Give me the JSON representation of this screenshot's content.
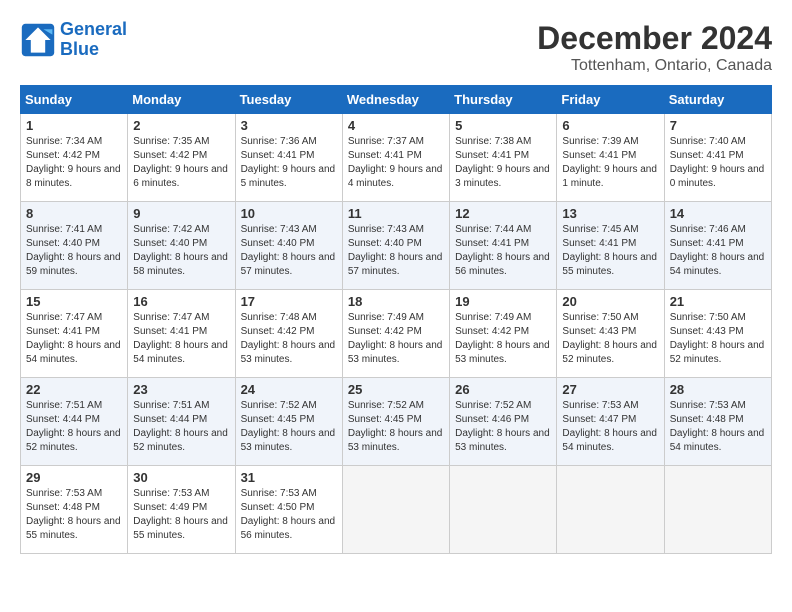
{
  "logo": {
    "line1": "General",
    "line2": "Blue"
  },
  "title": "December 2024",
  "subtitle": "Tottenham, Ontario, Canada",
  "headers": [
    "Sunday",
    "Monday",
    "Tuesday",
    "Wednesday",
    "Thursday",
    "Friday",
    "Saturday"
  ],
  "weeks": [
    [
      {
        "day": "1",
        "sunrise": "7:34 AM",
        "sunset": "4:42 PM",
        "daylight": "9 hours and 8 minutes."
      },
      {
        "day": "2",
        "sunrise": "7:35 AM",
        "sunset": "4:42 PM",
        "daylight": "9 hours and 6 minutes."
      },
      {
        "day": "3",
        "sunrise": "7:36 AM",
        "sunset": "4:41 PM",
        "daylight": "9 hours and 5 minutes."
      },
      {
        "day": "4",
        "sunrise": "7:37 AM",
        "sunset": "4:41 PM",
        "daylight": "9 hours and 4 minutes."
      },
      {
        "day": "5",
        "sunrise": "7:38 AM",
        "sunset": "4:41 PM",
        "daylight": "9 hours and 3 minutes."
      },
      {
        "day": "6",
        "sunrise": "7:39 AM",
        "sunset": "4:41 PM",
        "daylight": "9 hours and 1 minute."
      },
      {
        "day": "7",
        "sunrise": "7:40 AM",
        "sunset": "4:41 PM",
        "daylight": "9 hours and 0 minutes."
      }
    ],
    [
      {
        "day": "8",
        "sunrise": "7:41 AM",
        "sunset": "4:40 PM",
        "daylight": "8 hours and 59 minutes."
      },
      {
        "day": "9",
        "sunrise": "7:42 AM",
        "sunset": "4:40 PM",
        "daylight": "8 hours and 58 minutes."
      },
      {
        "day": "10",
        "sunrise": "7:43 AM",
        "sunset": "4:40 PM",
        "daylight": "8 hours and 57 minutes."
      },
      {
        "day": "11",
        "sunrise": "7:43 AM",
        "sunset": "4:40 PM",
        "daylight": "8 hours and 57 minutes."
      },
      {
        "day": "12",
        "sunrise": "7:44 AM",
        "sunset": "4:41 PM",
        "daylight": "8 hours and 56 minutes."
      },
      {
        "day": "13",
        "sunrise": "7:45 AM",
        "sunset": "4:41 PM",
        "daylight": "8 hours and 55 minutes."
      },
      {
        "day": "14",
        "sunrise": "7:46 AM",
        "sunset": "4:41 PM",
        "daylight": "8 hours and 54 minutes."
      }
    ],
    [
      {
        "day": "15",
        "sunrise": "7:47 AM",
        "sunset": "4:41 PM",
        "daylight": "8 hours and 54 minutes."
      },
      {
        "day": "16",
        "sunrise": "7:47 AM",
        "sunset": "4:41 PM",
        "daylight": "8 hours and 54 minutes."
      },
      {
        "day": "17",
        "sunrise": "7:48 AM",
        "sunset": "4:42 PM",
        "daylight": "8 hours and 53 minutes."
      },
      {
        "day": "18",
        "sunrise": "7:49 AM",
        "sunset": "4:42 PM",
        "daylight": "8 hours and 53 minutes."
      },
      {
        "day": "19",
        "sunrise": "7:49 AM",
        "sunset": "4:42 PM",
        "daylight": "8 hours and 53 minutes."
      },
      {
        "day": "20",
        "sunrise": "7:50 AM",
        "sunset": "4:43 PM",
        "daylight": "8 hours and 52 minutes."
      },
      {
        "day": "21",
        "sunrise": "7:50 AM",
        "sunset": "4:43 PM",
        "daylight": "8 hours and 52 minutes."
      }
    ],
    [
      {
        "day": "22",
        "sunrise": "7:51 AM",
        "sunset": "4:44 PM",
        "daylight": "8 hours and 52 minutes."
      },
      {
        "day": "23",
        "sunrise": "7:51 AM",
        "sunset": "4:44 PM",
        "daylight": "8 hours and 52 minutes."
      },
      {
        "day": "24",
        "sunrise": "7:52 AM",
        "sunset": "4:45 PM",
        "daylight": "8 hours and 53 minutes."
      },
      {
        "day": "25",
        "sunrise": "7:52 AM",
        "sunset": "4:45 PM",
        "daylight": "8 hours and 53 minutes."
      },
      {
        "day": "26",
        "sunrise": "7:52 AM",
        "sunset": "4:46 PM",
        "daylight": "8 hours and 53 minutes."
      },
      {
        "day": "27",
        "sunrise": "7:53 AM",
        "sunset": "4:47 PM",
        "daylight": "8 hours and 54 minutes."
      },
      {
        "day": "28",
        "sunrise": "7:53 AM",
        "sunset": "4:48 PM",
        "daylight": "8 hours and 54 minutes."
      }
    ],
    [
      {
        "day": "29",
        "sunrise": "7:53 AM",
        "sunset": "4:48 PM",
        "daylight": "8 hours and 55 minutes."
      },
      {
        "day": "30",
        "sunrise": "7:53 AM",
        "sunset": "4:49 PM",
        "daylight": "8 hours and 55 minutes."
      },
      {
        "day": "31",
        "sunrise": "7:53 AM",
        "sunset": "4:50 PM",
        "daylight": "8 hours and 56 minutes."
      },
      null,
      null,
      null,
      null
    ]
  ]
}
